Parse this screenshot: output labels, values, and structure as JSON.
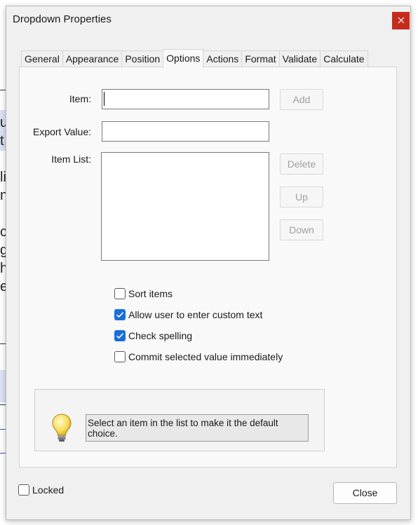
{
  "dialog": {
    "title": "Dropdown Properties",
    "close_icon": "close-x-icon"
  },
  "tabs": [
    {
      "label": "General",
      "active": false
    },
    {
      "label": "Appearance",
      "active": false
    },
    {
      "label": "Position",
      "active": false
    },
    {
      "label": "Options",
      "active": true
    },
    {
      "label": "Actions",
      "active": false
    },
    {
      "label": "Format",
      "active": false
    },
    {
      "label": "Validate",
      "active": false
    },
    {
      "label": "Calculate",
      "active": false
    }
  ],
  "options": {
    "item_label": "Item:",
    "item_value": "",
    "export_label": "Export Value:",
    "export_value": "",
    "item_list_label": "Item List:",
    "item_list": [],
    "add_button": "Add",
    "delete_button": "Delete",
    "up_button": "Up",
    "down_button": "Down",
    "checkboxes": [
      {
        "label": "Sort items",
        "checked": false
      },
      {
        "label": "Allow user to enter custom text",
        "checked": true
      },
      {
        "label": "Check spelling",
        "checked": true
      },
      {
        "label": "Commit selected value immediately",
        "checked": false
      }
    ],
    "hint": {
      "icon": "lightbulb-icon",
      "text": "Select an item in the list to make it the default choice."
    }
  },
  "footer": {
    "locked_label": "Locked",
    "locked_checked": false,
    "close_button": "Close"
  },
  "colors": {
    "accent": "#1a6ed8",
    "titlebar_close": "#c42b1c",
    "dialog_bg": "#f0f0f0",
    "panel_bg": "#f9f9f9"
  }
}
